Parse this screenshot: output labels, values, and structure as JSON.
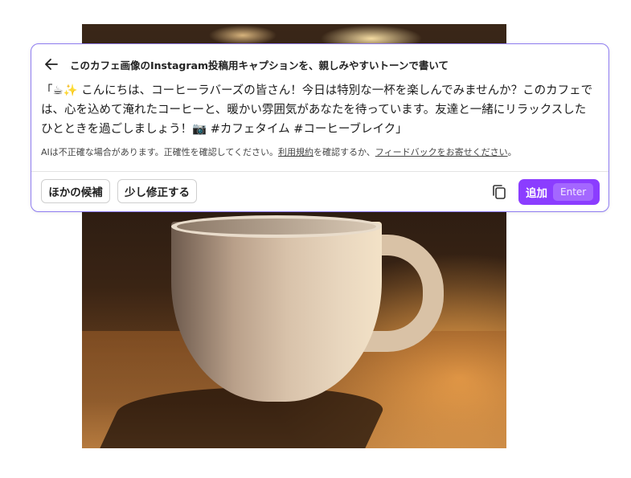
{
  "dialog": {
    "title": "このカフェ画像のInstagram投稿用キャプションを、親しみやすいトーンで書いて",
    "caption": "「☕✨ こんにちは、コーヒーラバーズの皆さん！今日は特別な一杯を楽しんでみませんか？このカフェでは、心を込めて淹れたコーヒーと、暖かい雰囲気があなたを待っています。友達と一緒にリラックスしたひとときを過ごしましょう！📷 #カフェタイム #コーヒーブレイク」",
    "disclaimer": {
      "prefix": "AIは不正確な場合があります。正確性を確認してください。",
      "terms_link": "利用規約",
      "middle": "を確認するか、",
      "feedback_link": "フィードバックをお寄せください",
      "suffix": "。"
    },
    "buttons": {
      "alternatives": "ほかの候補",
      "tweak": "少し修正する",
      "add": "追加",
      "add_shortcut": "Enter"
    }
  },
  "icons": {
    "back": "arrow-left-icon",
    "copy": "copy-icon"
  },
  "colors": {
    "accent": "#8b3dff",
    "dialog_border": "#8e7cf0"
  }
}
